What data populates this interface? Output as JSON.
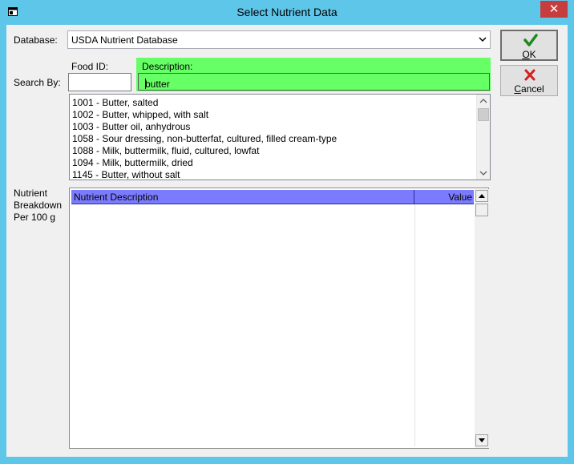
{
  "window": {
    "title": "Select Nutrient Data",
    "close_glyph": "✕",
    "icon": "window-app-icon",
    "chrome_color": "#5ec6e8"
  },
  "database": {
    "label": "Database:",
    "selected": "USDA Nutrient Database"
  },
  "search": {
    "label": "Search By:",
    "food_id_label": "Food ID:",
    "food_id_value": "",
    "description_label": "Description:",
    "description_value": "butter",
    "description_bg": "#66ff66"
  },
  "results": [
    "1001 - Butter, salted",
    "1002 - Butter, whipped, with salt",
    "1003 - Butter oil, anhydrous",
    "1058 - Sour dressing, non-butterfat, cultured, filled cream-type",
    "1088 - Milk, buttermilk, fluid, cultured, lowfat",
    "1094 - Milk, buttermilk, dried",
    "1145 - Butter, without salt"
  ],
  "breakdown": {
    "label_line1": "Nutrient",
    "label_line2": "Breakdown",
    "label_line3": "Per 100 g",
    "columns": [
      "Nutrient Description",
      "Value"
    ],
    "header_bg": "#7b7bff",
    "rows": []
  },
  "buttons": {
    "ok_label": "OK",
    "ok_mnemonic": "O",
    "ok_rest": "K",
    "ok_icon": "checkmark-icon",
    "cancel_label": "Cancel",
    "cancel_mnemonic": "C",
    "cancel_rest": "ancel",
    "cancel_icon": "red-x-icon"
  }
}
